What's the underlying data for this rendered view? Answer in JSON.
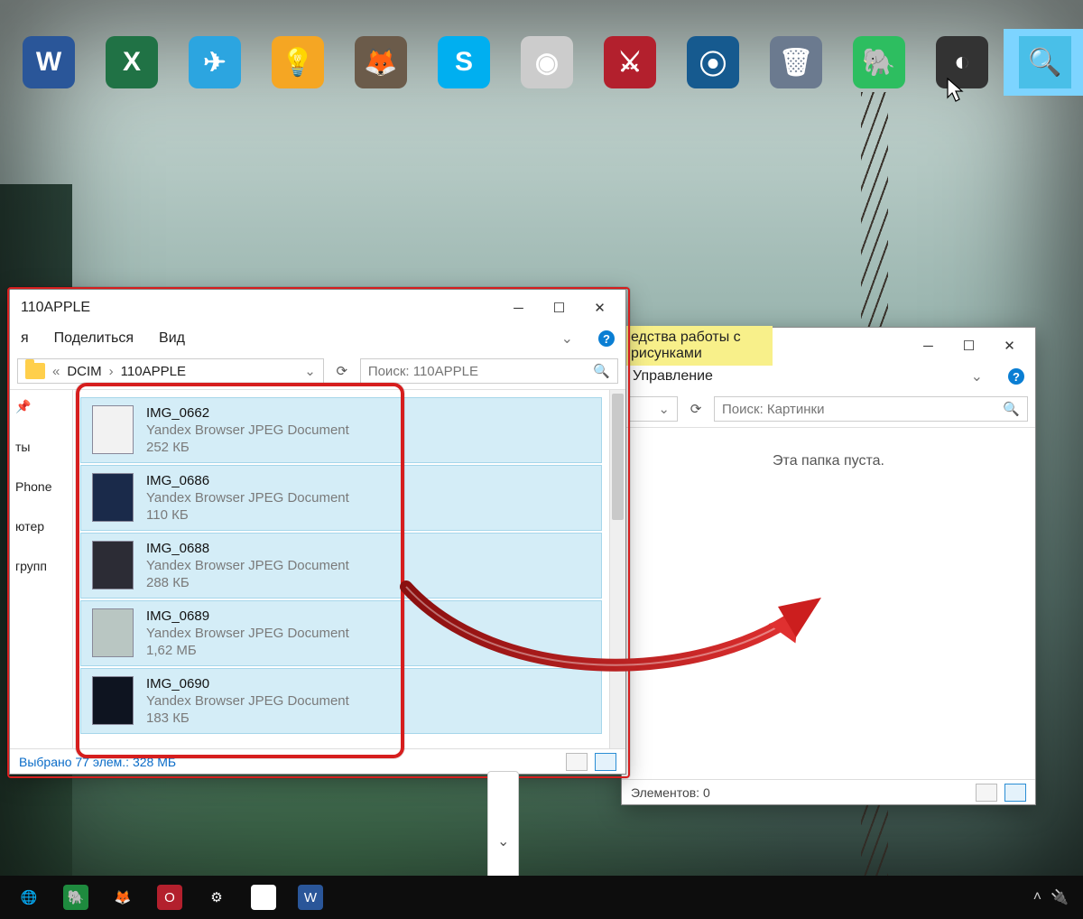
{
  "dock": {
    "apps": [
      {
        "name": "word-icon",
        "color": "#2a5699",
        "glyph": "W"
      },
      {
        "name": "excel-icon",
        "color": "#207245",
        "glyph": "X"
      },
      {
        "name": "telegram-icon",
        "color": "#2ca5e0",
        "glyph": "✈"
      },
      {
        "name": "lightbulb-icon",
        "color": "#f5a623",
        "glyph": "💡"
      },
      {
        "name": "gimp-icon",
        "color": "#6b5b4a",
        "glyph": "🦊"
      },
      {
        "name": "skype-icon",
        "color": "#00aff0",
        "glyph": "S"
      },
      {
        "name": "chrome-icon",
        "color": "#cccccc",
        "glyph": "◉"
      },
      {
        "name": "delphi-icon",
        "color": "#b3202d",
        "glyph": "⚔"
      },
      {
        "name": "steam-icon",
        "color": "#165a8f",
        "glyph": "⦿"
      },
      {
        "name": "recycle-icon",
        "color": "#6b7a8f",
        "glyph": "🗑"
      },
      {
        "name": "evernote-icon",
        "color": "#2dbe60",
        "glyph": "🐘"
      },
      {
        "name": "obs-icon",
        "color": "#333333",
        "glyph": "◐"
      },
      {
        "name": "magnifier-icon",
        "color": "#49bfe8",
        "glyph": "🔍",
        "selected": true
      }
    ]
  },
  "window1": {
    "title": "110APPLE",
    "menu_items": [
      "я",
      "Поделиться",
      "Вид"
    ],
    "breadcrumb": {
      "prefix": "«",
      "parts": [
        "DCIM",
        "110APPLE"
      ]
    },
    "search_placeholder": "Поиск: 110APPLE",
    "sidebar": [
      "ты",
      "Phone",
      "ютер",
      "групп"
    ],
    "pin_tooltip": "Закрепить",
    "files": [
      {
        "name": "IMG_0662",
        "type": "Yandex Browser JPEG Document",
        "size": "252 КБ",
        "thumb": "#f2f2f2"
      },
      {
        "name": "IMG_0686",
        "type": "Yandex Browser JPEG Document",
        "size": "110 КБ",
        "thumb": "#1a2a4a"
      },
      {
        "name": "IMG_0688",
        "type": "Yandex Browser JPEG Document",
        "size": "288 КБ",
        "thumb": "#2c2c35"
      },
      {
        "name": "IMG_0689",
        "type": "Yandex Browser JPEG Document",
        "size": "1,62 МБ",
        "thumb": "#b9c6c2"
      },
      {
        "name": "IMG_0690",
        "type": "Yandex Browser JPEG Document",
        "size": "183 КБ",
        "thumb": "#0e1420"
      }
    ],
    "status": "Выбрано 77 элем.: 328 МБ"
  },
  "window2": {
    "tab_highlight": "едства работы с рисунками",
    "tab_manage": "Управление",
    "search_placeholder": "Поиск: Картинки",
    "empty_text": "Эта папка пуста.",
    "status": "Элементов: 0"
  },
  "taskbar": {
    "items": [
      {
        "name": "chrome-taskbar-icon",
        "color": "transparent",
        "glyph": "🌐"
      },
      {
        "name": "evernote-taskbar-icon",
        "color": "#1e8a3e",
        "glyph": "🐘"
      },
      {
        "name": "gimp-taskbar-icon",
        "color": "transparent",
        "glyph": "🦊"
      },
      {
        "name": "opera-taskbar-icon",
        "color": "#b3202d",
        "glyph": "O"
      },
      {
        "name": "settings-taskbar-icon",
        "color": "transparent",
        "glyph": "⚙"
      },
      {
        "name": "itunes-taskbar-icon",
        "color": "#ffffff",
        "glyph": "♫"
      },
      {
        "name": "word-taskbar-icon",
        "color": "#2a5699",
        "glyph": "W"
      }
    ]
  }
}
